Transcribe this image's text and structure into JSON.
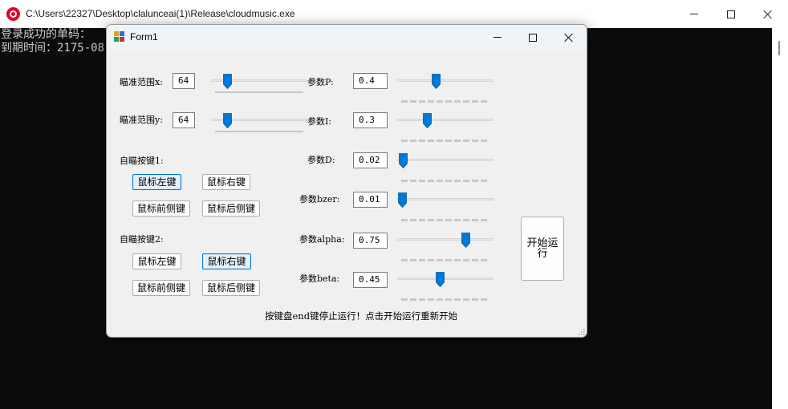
{
  "console": {
    "title": "C:\\Users\\22327\\Desktop\\clalunceai(1)\\Release\\cloudmusic.exe",
    "lines": [
      "登录成功的单码：",
      "到期时间：2175-08"
    ]
  },
  "form": {
    "title": "Form1",
    "rows": [
      {
        "label": "瞄准范围x:",
        "value": "64"
      },
      {
        "label": "瞄准范围y:",
        "value": "64"
      }
    ],
    "key1_label": "自瞄按键1:",
    "key2_label": "自瞄按键2:",
    "key_buttons": [
      "鼠标左键",
      "鼠标右键",
      "鼠标前侧键",
      "鼠标后侧键"
    ],
    "params": [
      {
        "label": "参数P:",
        "value": "0.4"
      },
      {
        "label": "参数I:",
        "value": "0.3"
      },
      {
        "label": "参数D:",
        "value": "0.02"
      },
      {
        "label": "参数bzer:",
        "value": "0.01"
      },
      {
        "label": "参数alpha:",
        "value": "0.75"
      },
      {
        "label": "参数beta:",
        "value": "0.45"
      }
    ],
    "start_button": "开始运行",
    "hint": "按键盘end键停止运行！点击开始运行重新开始"
  },
  "colors": {
    "accent": "#0078d7",
    "selected_button_bg": "#e5f1fb",
    "console_bg": "#0c0c0c",
    "console_text": "#cccccc",
    "form_bg": "#f0f0f0"
  }
}
